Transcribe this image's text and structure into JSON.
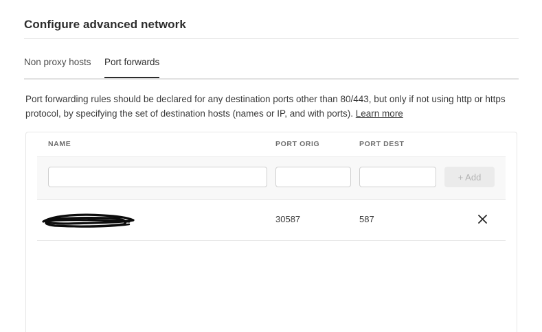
{
  "page": {
    "title": "Configure advanced network"
  },
  "tabs": [
    {
      "label": "Non proxy hosts",
      "active": false
    },
    {
      "label": "Port forwards",
      "active": true
    }
  ],
  "description": {
    "text": "Port forwarding rules should be declared for any destination ports other than 80/443, but only if not using http or https protocol, by specifying the set of destination hosts (names or IP, and with ports).",
    "link_label": "Learn more"
  },
  "table": {
    "columns": [
      "NAME",
      "PORT ORIG",
      "PORT DEST"
    ],
    "form": {
      "name_value": "",
      "port_orig_value": "",
      "port_dest_value": "",
      "add_label": "+ Add"
    },
    "rows": [
      {
        "name_icon": "redacted-scribble",
        "port_orig": "30587",
        "port_dest": "587",
        "remove_icon": "close-icon"
      }
    ]
  },
  "colors": {
    "text": "#2c2c2c",
    "muted_header": "#6e6e6e",
    "divider": "#e1e1e1",
    "form_bg": "#f8f8f8",
    "add_disabled_bg": "#ebebeb",
    "add_disabled_text": "#b3b3b3"
  }
}
